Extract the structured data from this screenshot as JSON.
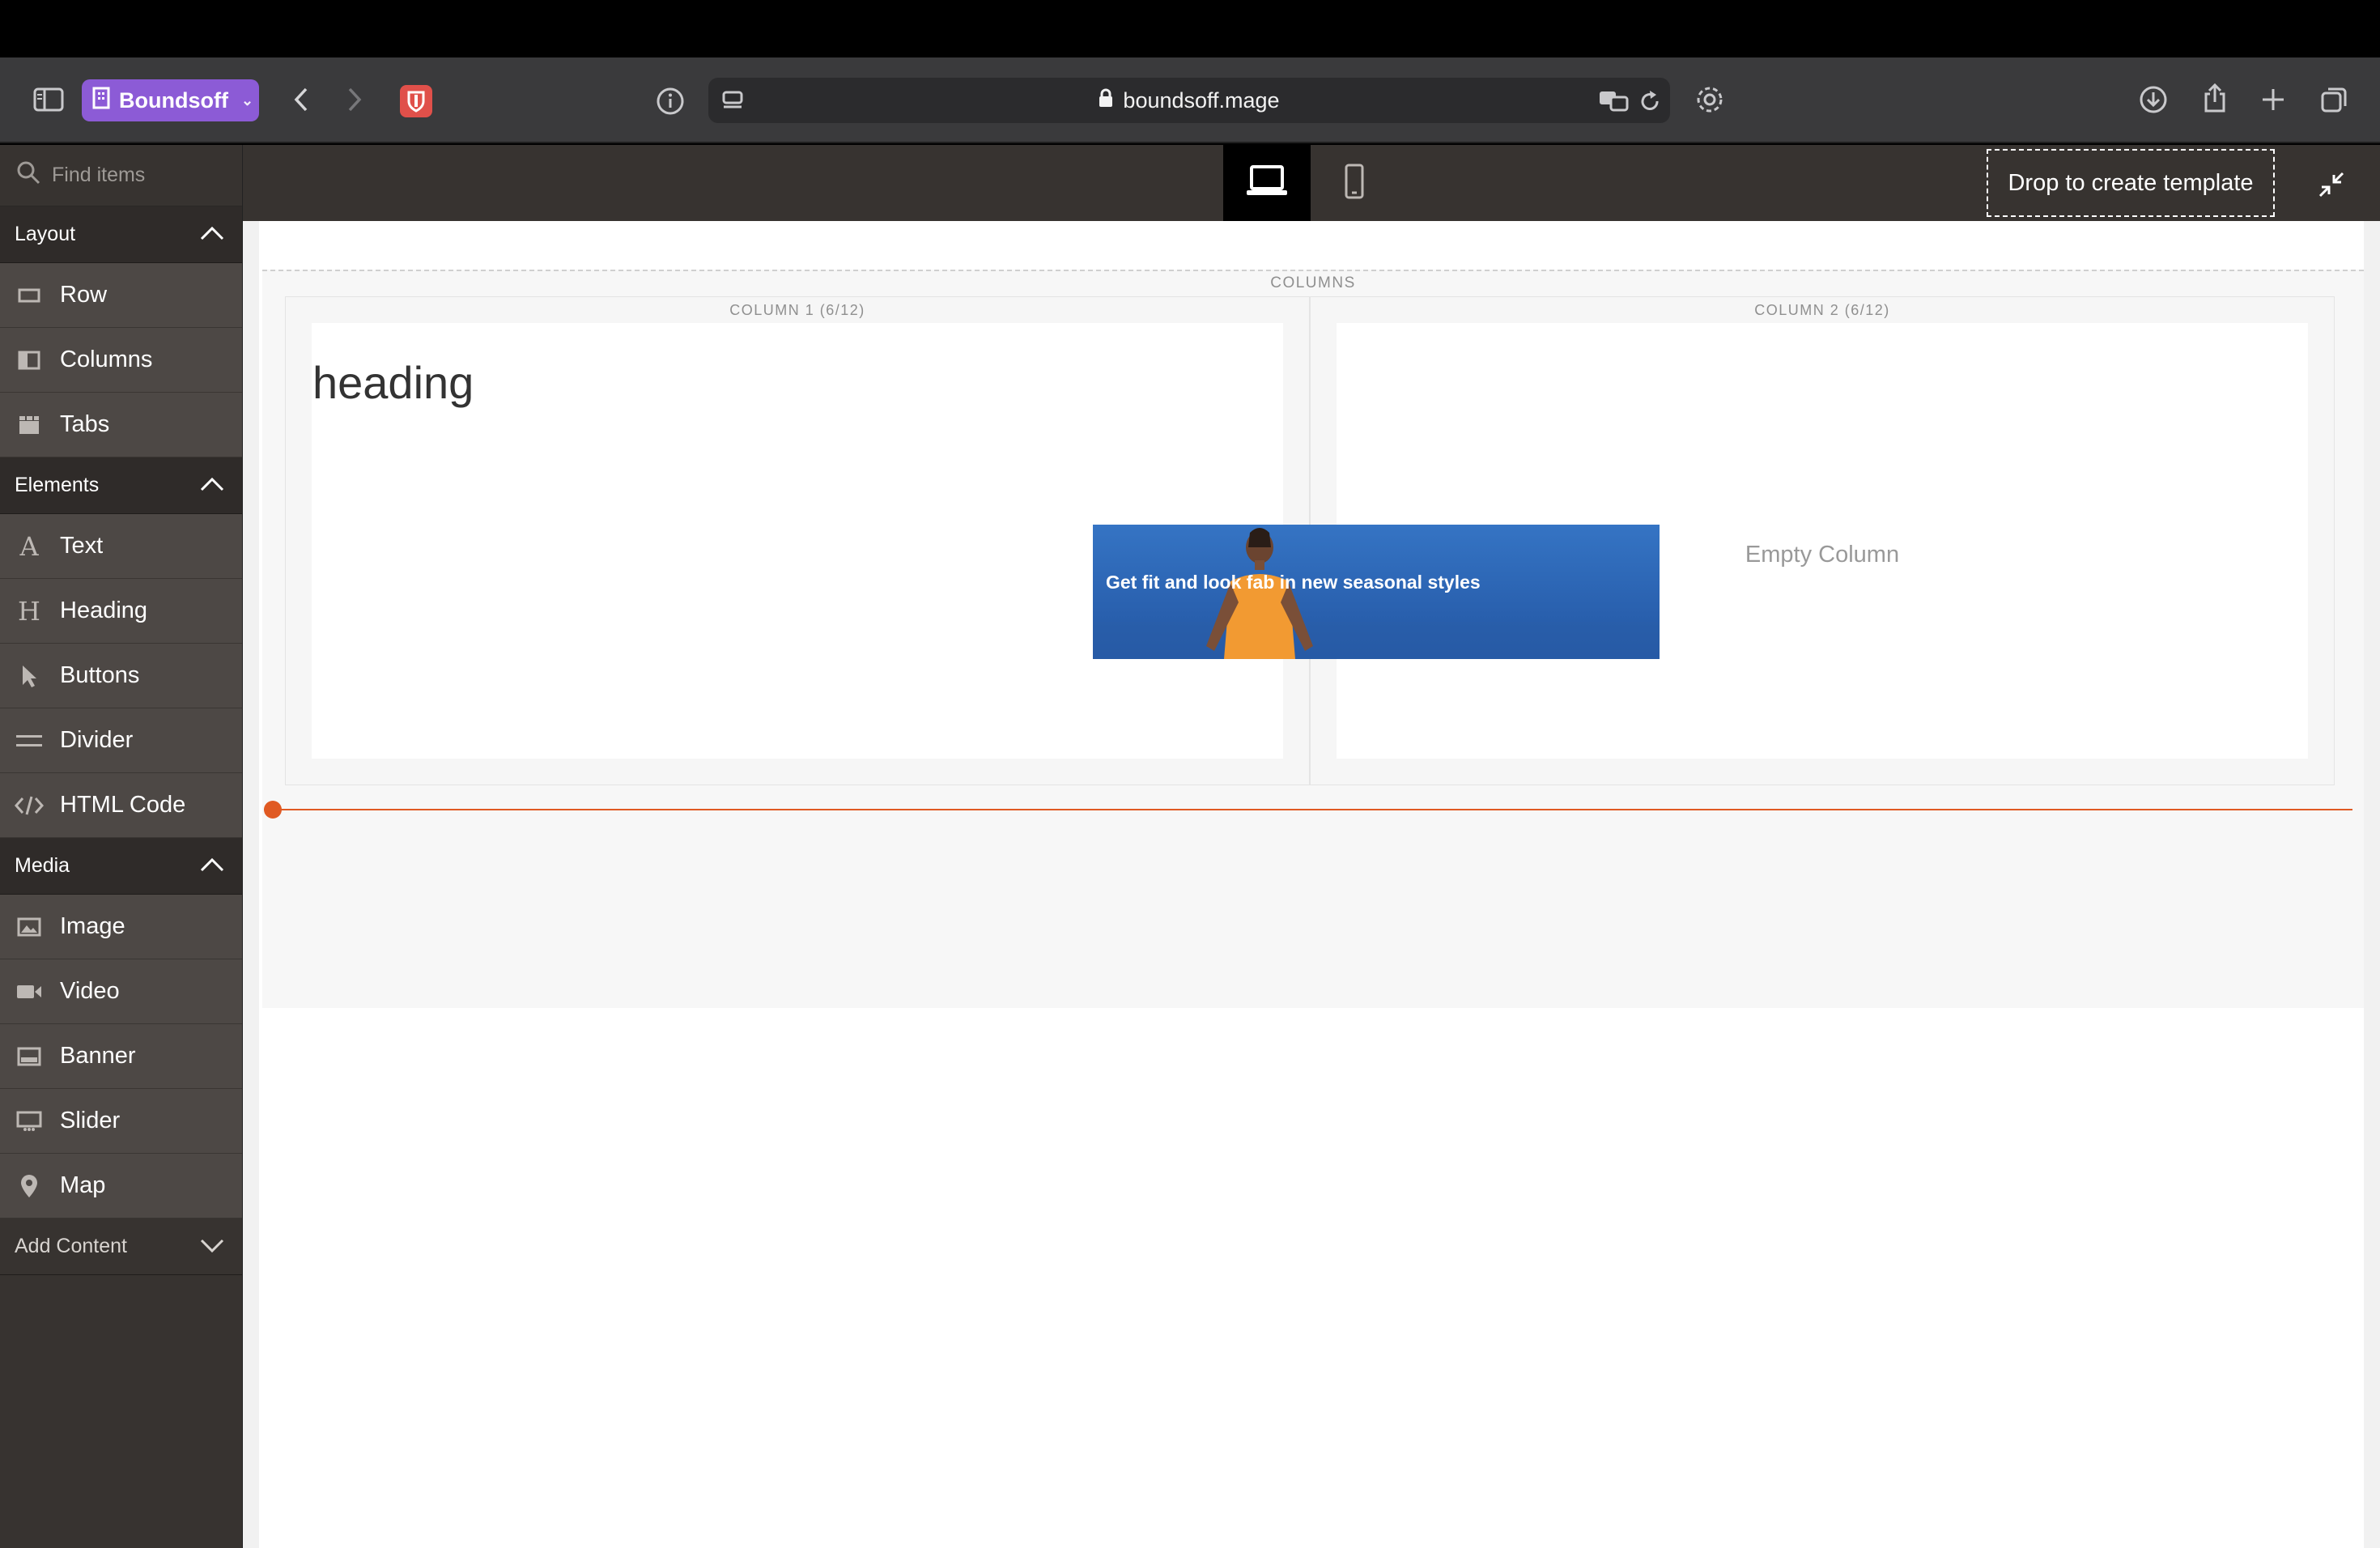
{
  "browser": {
    "profile_name": "Boundsoff",
    "url": "boundsoff.mage"
  },
  "builder": {
    "template_drop_label": "Drop to create template"
  },
  "sidebar": {
    "search_placeholder": "Find items",
    "sections": {
      "layout": {
        "label": "Layout",
        "items": [
          "Row",
          "Columns",
          "Tabs"
        ]
      },
      "elements": {
        "label": "Elements",
        "items": [
          "Text",
          "Heading",
          "Buttons",
          "Divider",
          "HTML Code"
        ]
      },
      "media": {
        "label": "Media",
        "items": [
          "Image",
          "Video",
          "Banner",
          "Slider",
          "Map"
        ]
      },
      "add_content": {
        "label": "Add Content"
      }
    }
  },
  "canvas": {
    "columns_label": "COLUMNS",
    "column1_label": "COLUMN 1 (6/12)",
    "column2_label": "COLUMN 2 (6/12)",
    "heading_text": "heading",
    "empty_column_text": "Empty Column",
    "banner_text": "Get fit and look fab in new seasonal styles"
  },
  "colors": {
    "profile_accent": "#8c5bd6",
    "drop_indicator": "#e05a23",
    "banner_blue": "#2f6bbd"
  }
}
